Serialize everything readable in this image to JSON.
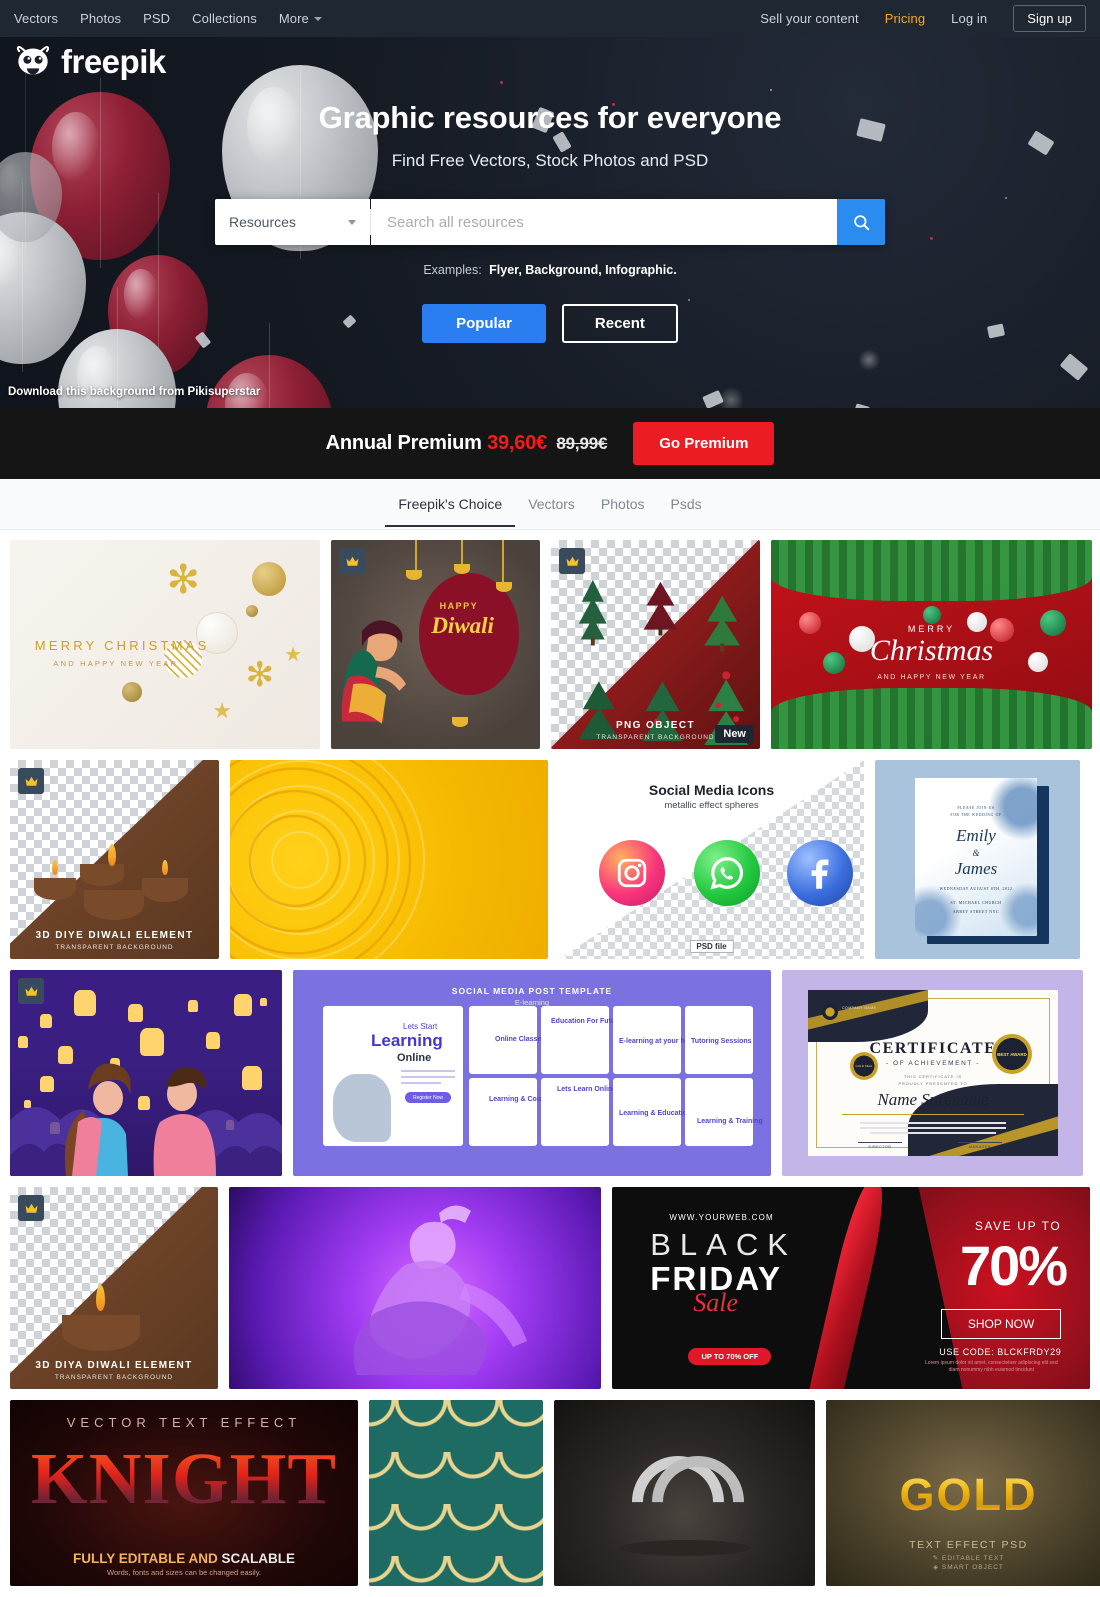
{
  "topnav": {
    "left": [
      {
        "label": "Vectors",
        "name": "nav-vectors"
      },
      {
        "label": "Photos",
        "name": "nav-photos"
      },
      {
        "label": "PSD",
        "name": "nav-psd"
      },
      {
        "label": "Collections",
        "name": "nav-collections"
      },
      {
        "label": "More",
        "name": "nav-more",
        "caret": true
      }
    ],
    "sell": "Sell your content",
    "pricing": "Pricing",
    "login": "Log in",
    "signup": "Sign up"
  },
  "hero": {
    "logo_text": "freepik",
    "title": "Graphic resources for everyone",
    "subtitle": "Find Free Vectors, Stock Photos and PSD",
    "search": {
      "selected_category": "Resources",
      "placeholder": "Search all resources",
      "value": ""
    },
    "examples_label": "Examples:",
    "examples_links": "Flyer, Background, Infographic.",
    "btn_popular": "Popular",
    "btn_recent": "Recent",
    "attribution": "Download this background from Pikisuperstar"
  },
  "premium": {
    "label": "Annual Premium",
    "price": "39,60€",
    "old_price": "89,99€",
    "cta": "Go Premium"
  },
  "tabs": [
    {
      "label": "Freepik's Choice",
      "active": true
    },
    {
      "label": "Vectors",
      "active": false
    },
    {
      "label": "Photos",
      "active": false
    },
    {
      "label": "Psds",
      "active": false
    }
  ],
  "grid": {
    "row1": {
      "xmas_gold": {
        "line1": "MERRY CHRISTMAS",
        "line2": "AND HAPPY NEW YEAR"
      },
      "diwali": {
        "happy": "HAPPY",
        "title": "Diwali",
        "premium": true
      },
      "trees": {
        "cap1": "PNG OBJECT",
        "cap2": "TRANSPARENT BACKGROUND",
        "badge_new": "New",
        "premium": true
      },
      "xmas_red": {
        "line1": "MERRY",
        "line2": "Christmas",
        "line3": "AND HAPPY NEW YEAR"
      }
    },
    "row2": {
      "diya": {
        "cap1": "3D DIYE DIWALI ELEMENT",
        "cap2": "TRANSPARENT BACKGROUND",
        "premium": true
      },
      "mandala": {},
      "social": {
        "title": "Social Media Icons",
        "subtitle": "metallic effect spheres",
        "tag": "PSD file"
      },
      "wedding": {
        "pre1": "PLEASE JOIN US",
        "pre2": "FOR THE WEDDING OF",
        "name1": "Emily",
        "amp": "&",
        "name2": "James",
        "date": "WEDNESDAY  AUGUST 8TH, 2022",
        "venue1": "ST. MICHAEL CHURCH",
        "venue2": "ABBEY STREET  NYC"
      }
    },
    "row3": {
      "lanterns": {
        "premium": true
      },
      "elearning": {
        "header": "SOCIAL MEDIA POST TEMPLATE",
        "subheader": "E-learning",
        "p1a": "Lets Start",
        "p1b": "Learning",
        "p1c": "Online",
        "p2": "Online Classes",
        "p3": "Education For Future",
        "p4": "E-learning at your home",
        "p5": "Tutoring Sessions",
        "p6": "Learning & Courses",
        "p7": "Lets Learn Online",
        "p8": "Learning & Education",
        "p9": "Learning & Training",
        "cta": "Register Now"
      },
      "certificate": {
        "title": "CERTIFICATE",
        "subtitle": "- OF ACHIEVEMENT -",
        "presented1": "THIS CERTIFICATE IS",
        "presented2": "PROUDLY PRESENTED TO",
        "name": "Name Surename",
        "seal": "GOLD SEAL",
        "award": "BEST AWARD",
        "company": "COMPANY NAME",
        "sign1": "DIRECTOR",
        "sign2": "MANAGER"
      }
    },
    "row4": {
      "diya2": {
        "cap1": "3D DIYA DIWALI ELEMENT",
        "cap2": "TRANSPARENT BACKGROUND",
        "premium": true
      },
      "purple": {},
      "blackfriday": {
        "url": "WWW.YOURWEB.COM",
        "black": "BLACK",
        "friday": "FRIDAY",
        "sale": "Sale",
        "pill": "UP TO 70% OFF",
        "save": "SAVE UP TO",
        "percent": "70%",
        "shop": "SHOP NOW",
        "code": "USE CODE: BLCKFRDY29",
        "lorem": "Lorem ipsum dolor sit amet, consectetuer adipiscing elit sed diam nonummy nibh euismod tincidunt"
      }
    },
    "row5": {
      "knight": {
        "top": "VECTOR TEXT EFFECT",
        "word": "KNIGHT",
        "line1a": "FULLY EDITABLE AND ",
        "line1b": "SCALABLE",
        "line2": "Words, fonts and sizes can be changed easily."
      },
      "pattern": {},
      "rings": {},
      "gold": {
        "word": "GOLD",
        "t": "TEXT EFFECT PSD",
        "s1": "✎ EDITABLE TEXT",
        "s2": "◈ SMART OBJECT"
      }
    }
  },
  "colors": {
    "nav_bg": "#1f2733",
    "accent_blue": "#2b7ef0",
    "premium_red": "#ec1c24",
    "pricing_orange": "#f5a623"
  }
}
